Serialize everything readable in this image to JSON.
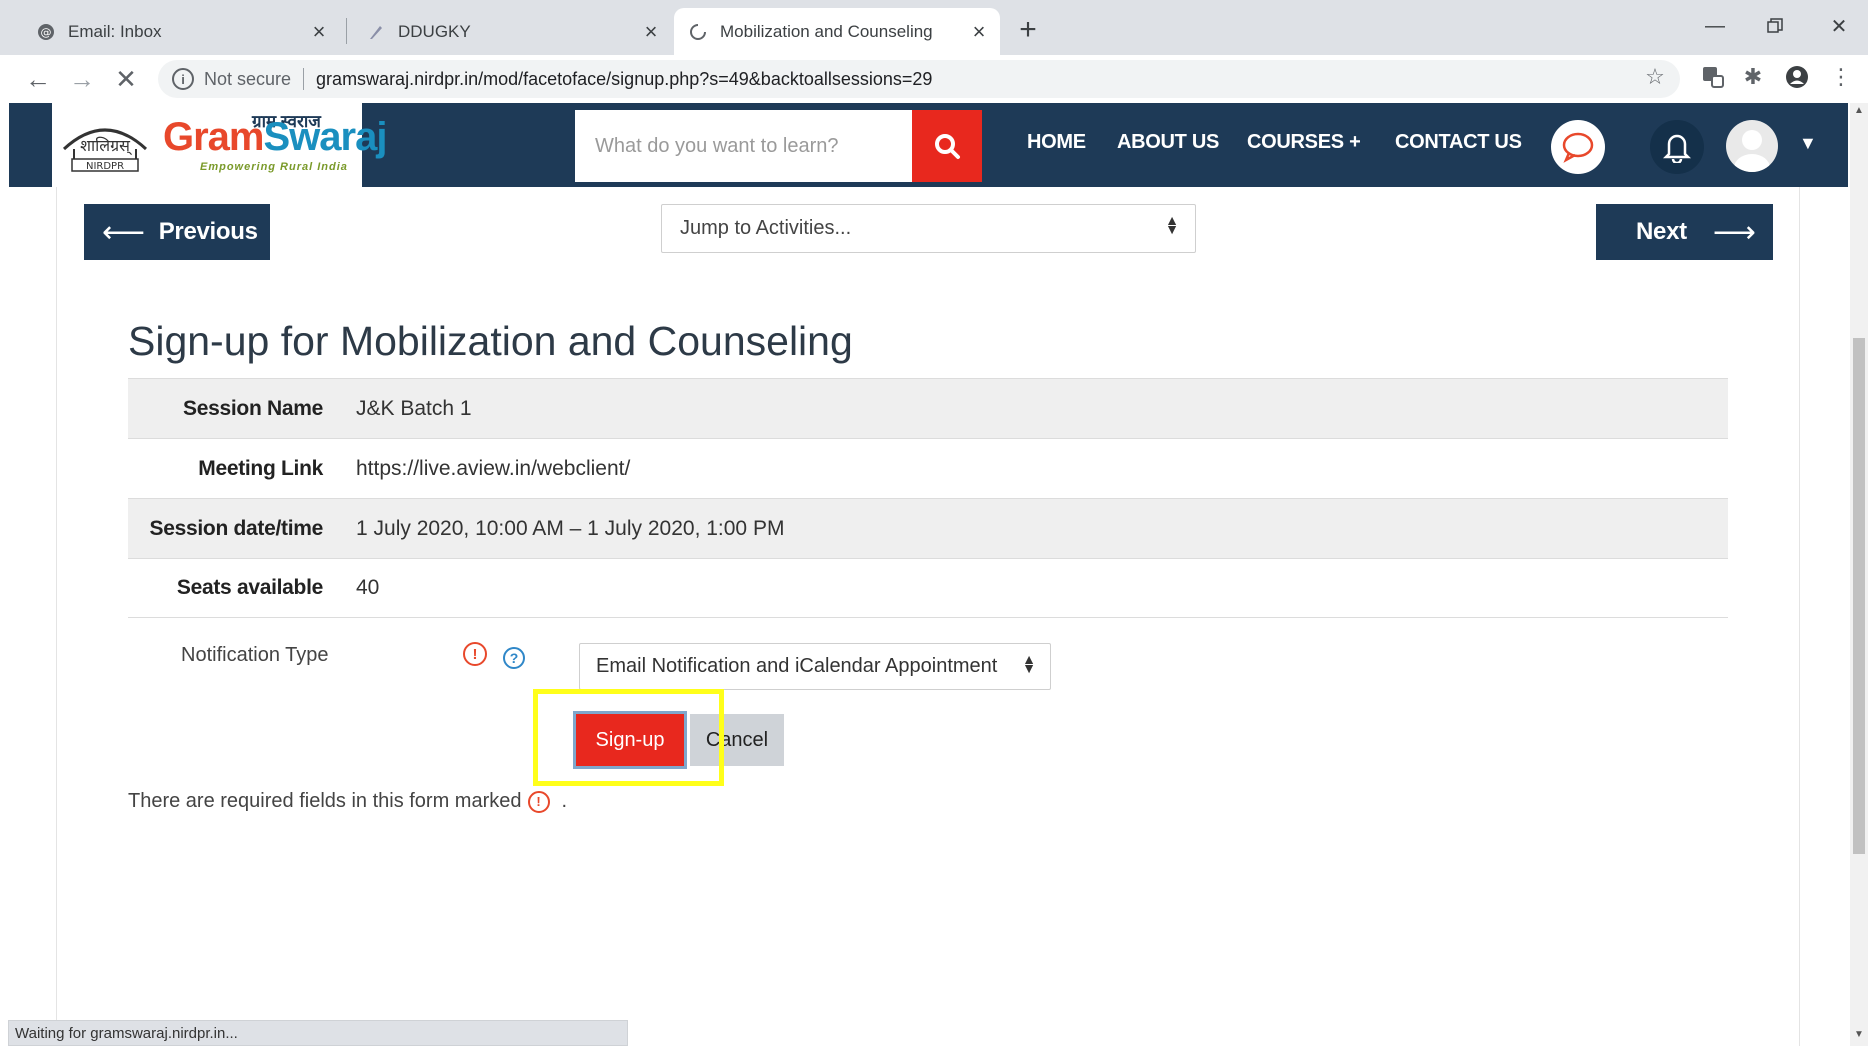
{
  "browser": {
    "tabs": [
      {
        "title": "Email: Inbox",
        "favicon": "email-icon"
      },
      {
        "title": "DDUGKY",
        "favicon": "feather-icon"
      },
      {
        "title": "Mobilization and Counseling",
        "favicon": "loading-spinner-icon"
      }
    ],
    "address": {
      "security": "Not secure",
      "url": "gramswaraj.nirdpr.in/mod/facetoface/signup.php?s=49&backtoallsessions=29"
    },
    "status": "Waiting for gramswaraj.nirdpr.in..."
  },
  "site": {
    "logo": {
      "emblem_text": "NIRDPR",
      "brand_part1": "Gram",
      "brand_part2": "Swaraj",
      "hindi": "ग्राम स्वराज",
      "tagline": "Empowering Rural India"
    },
    "search_placeholder": "What do you want to learn?",
    "nav": {
      "home": "HOME",
      "about": "ABOUT US",
      "courses": "COURSES +",
      "contact": "CONTACT US"
    }
  },
  "activity_nav": {
    "previous": "Previous",
    "next": "Next",
    "jump": "Jump to Activities..."
  },
  "page": {
    "title": "Sign-up for Mobilization and Counseling",
    "details": [
      {
        "label": "Session Name",
        "value": "J&K Batch 1"
      },
      {
        "label": "Meeting Link",
        "value": "https://live.aview.in/webclient/"
      },
      {
        "label": "Session date/time",
        "value": "1 July 2020, 10:00 AM – 1 July 2020, 1:00 PM"
      },
      {
        "label": "Seats available",
        "value": "40"
      }
    ],
    "notification_label": "Notification Type",
    "notification_value": "Email Notification and iCalendar Appointment",
    "signup_label": "Sign-up",
    "cancel_label": "Cancel",
    "required_note": "There are required fields in this form marked",
    "required_note_end": "."
  },
  "colors": {
    "header": "#1e3a57",
    "accent_red": "#e8281e",
    "highlight": "#ffff1a"
  }
}
